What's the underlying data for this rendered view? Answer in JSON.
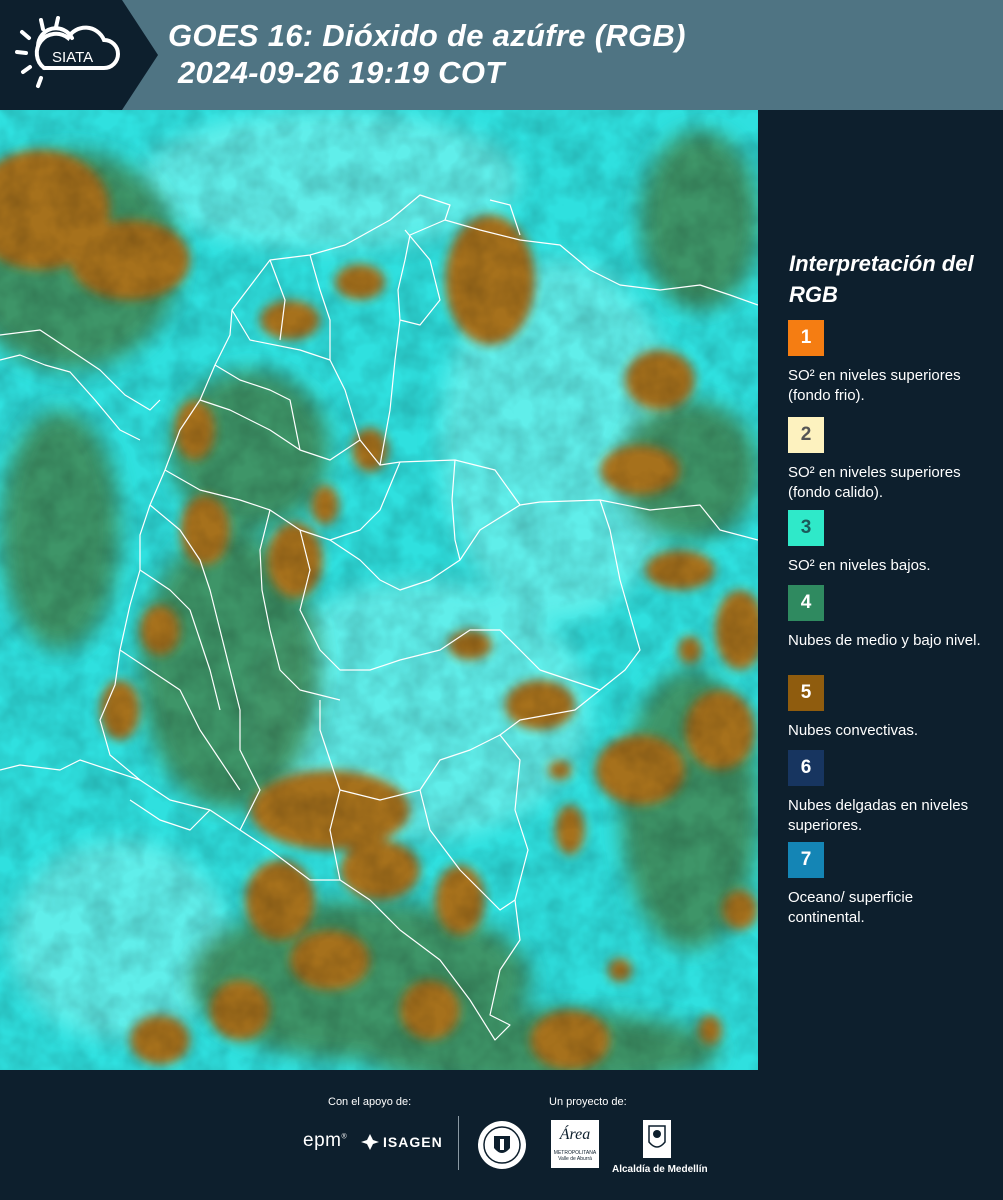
{
  "header": {
    "logo_text": "SIATA",
    "title_line1": "GOES 16: Dióxido de azúfre (RGB)",
    "title_line2": "2024-09-26 19:19 COT"
  },
  "legend": {
    "title": "Interpretación del RGB",
    "items": [
      {
        "num": "1",
        "color": "#f57d12",
        "num_color": "#ffffff",
        "text": "SO² en niveles superiores (fondo frio)."
      },
      {
        "num": "2",
        "color": "#fdf2bf",
        "num_color": "#555555",
        "text": "SO² en niveles superiores (fondo calido)."
      },
      {
        "num": "3",
        "color": "#2fe9c9",
        "num_color": "#1b5a5a",
        "text": "SO² en niveles bajos."
      },
      {
        "num": "4",
        "color": "#2f8a60",
        "num_color": "#ffffff",
        "text": "Nubes de medio y bajo nivel."
      },
      {
        "num": "5",
        "color": "#8f5c0e",
        "num_color": "#ffffff",
        "text": "Nubes convectivas."
      },
      {
        "num": "6",
        "color": "#173560",
        "num_color": "#ffffff",
        "text": "Nubes delgadas en niveles superiores."
      },
      {
        "num": "7",
        "color": "#1485b5",
        "num_color": "#ffffff",
        "text": "Oceano/ superficie continental."
      }
    ]
  },
  "footer": {
    "support_label": "Con el apoyo de:",
    "project_label": "Un proyecto de:",
    "sponsor1": "epm",
    "sponsor2": "ISAGEN",
    "partner_area": "Área",
    "partner_metro": "METROPOLITANA",
    "partner_valle": "Valle de Aburrá",
    "partner_alcaldia": "Alcaldía de Medellín"
  },
  "colors": {
    "background": "#0d1f2d",
    "header": "#4f7483",
    "map_cyan": "#2fe0df",
    "cloud_brown": "#a8731c",
    "cloud_green": "#3d8a5a"
  }
}
